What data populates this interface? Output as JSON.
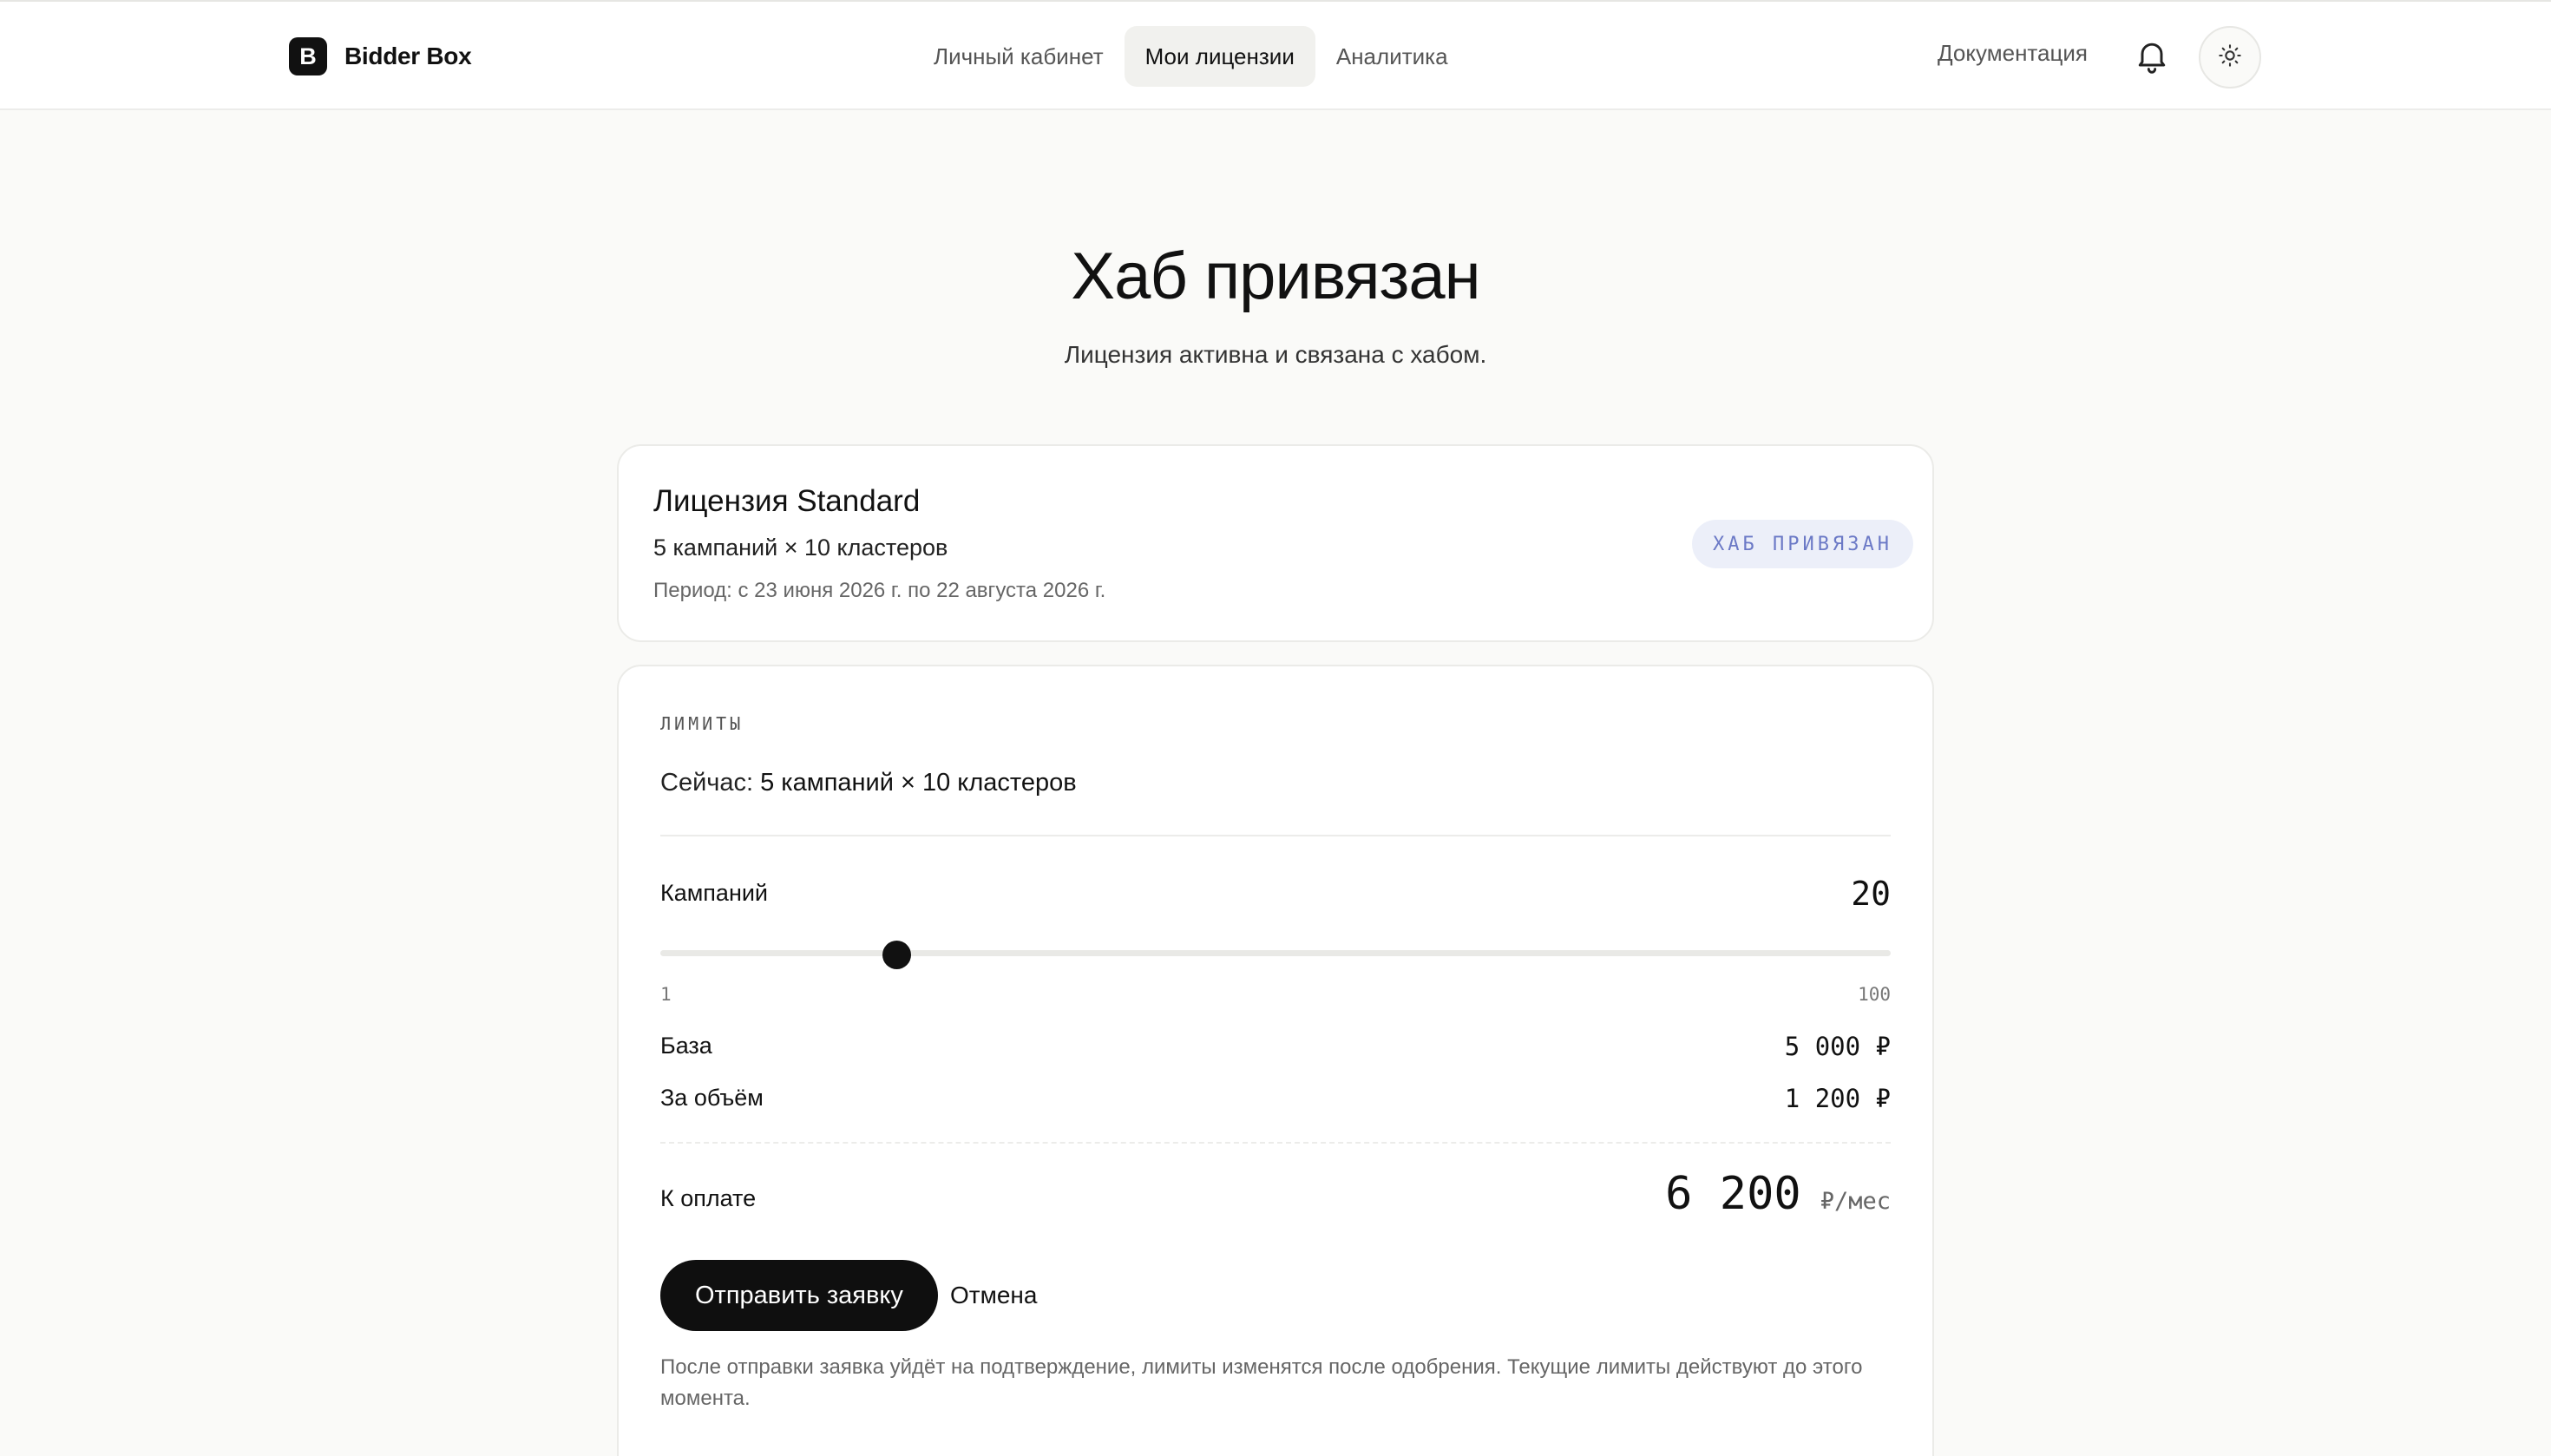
{
  "header": {
    "brand_letter": "B",
    "brand_name": "Bidder Box",
    "nav": [
      {
        "label": "Личный кабинет",
        "active": false
      },
      {
        "label": "Мои лицензии",
        "active": true
      },
      {
        "label": "Аналитика",
        "active": false
      }
    ],
    "docs_label": "Документация",
    "bell_icon": "bell-icon",
    "theme_icon": "sun-icon"
  },
  "hero": {
    "title": "Хаб привязан",
    "subtitle": "Лицензия активна и связана с хабом."
  },
  "license": {
    "title": "Лицензия Standard",
    "limits": "5 кампаний × 10 кластеров",
    "period": "Период: с 23 июня 2026 г. по 22 августа 2026 г.",
    "badge": "ХАБ ПРИВЯЗАН",
    "badge_color": "#6b79c6"
  },
  "limits": {
    "section_label": "ЛИМИТЫ",
    "current_prefix": "Сейчас: ",
    "current_value": "5 кампаний × 10 кластеров",
    "campaigns_label": "Кампаний",
    "campaigns_value": 20,
    "slider_min": 1,
    "slider_max": 100,
    "slider_min_label": "1",
    "slider_max_label": "100",
    "base_label": "База",
    "base_value": "5 000 ₽",
    "volume_label": "За объём",
    "volume_value": "1 200 ₽",
    "total_label": "К оплате",
    "total_amount": "6 200",
    "total_unit": "₽/мес",
    "submit_label": "Отправить заявку",
    "cancel_label": "Отмена",
    "note": "После отправки заявка уйдёт на подтверждение, лимиты изменятся после одобрения. Текущие лимиты действуют до этого момента."
  }
}
